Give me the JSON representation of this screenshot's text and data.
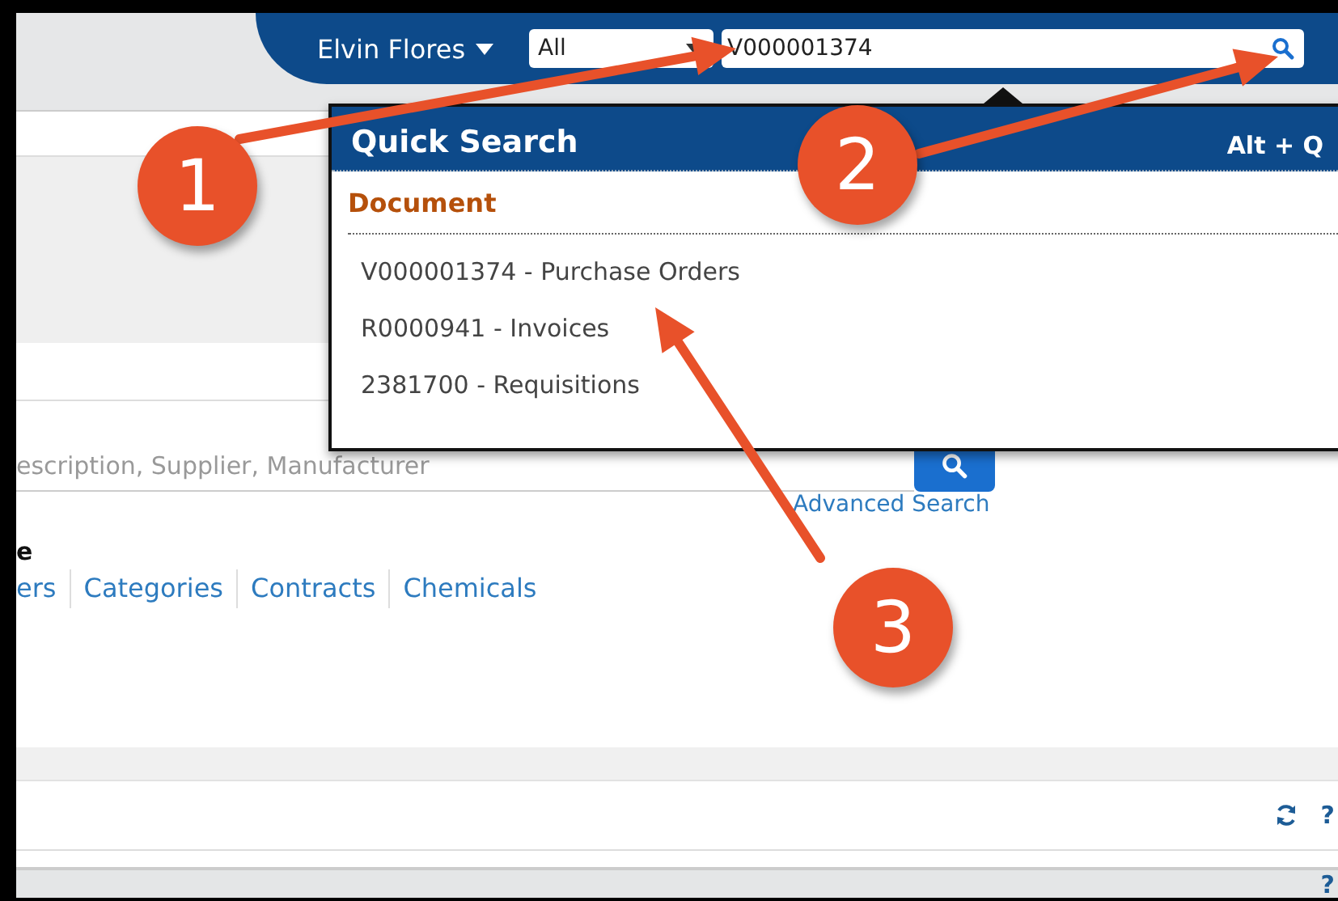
{
  "header": {
    "user_menu": "Elvin Flores",
    "scope_select": "All",
    "search_input": "V000001374"
  },
  "quick_search": {
    "title": "Quick Search",
    "shortcut": "Alt + Q",
    "section": "Document",
    "results": [
      {
        "label": "V000001374 - Purchase Orders"
      },
      {
        "label": "R0000941 - Invoices"
      },
      {
        "label": "2381700 - Requisitions"
      }
    ]
  },
  "page": {
    "search_placeholder": "escription, Supplier, Manufacturer",
    "advanced_search": "Advanced Search",
    "section_label": "e",
    "links": [
      "ers",
      "Categories",
      "Contracts",
      "Chemicals"
    ],
    "row_help": "?",
    "footer_help": "?"
  },
  "annotations": [
    {
      "number": "1"
    },
    {
      "number": "2"
    },
    {
      "number": "3"
    }
  ]
}
